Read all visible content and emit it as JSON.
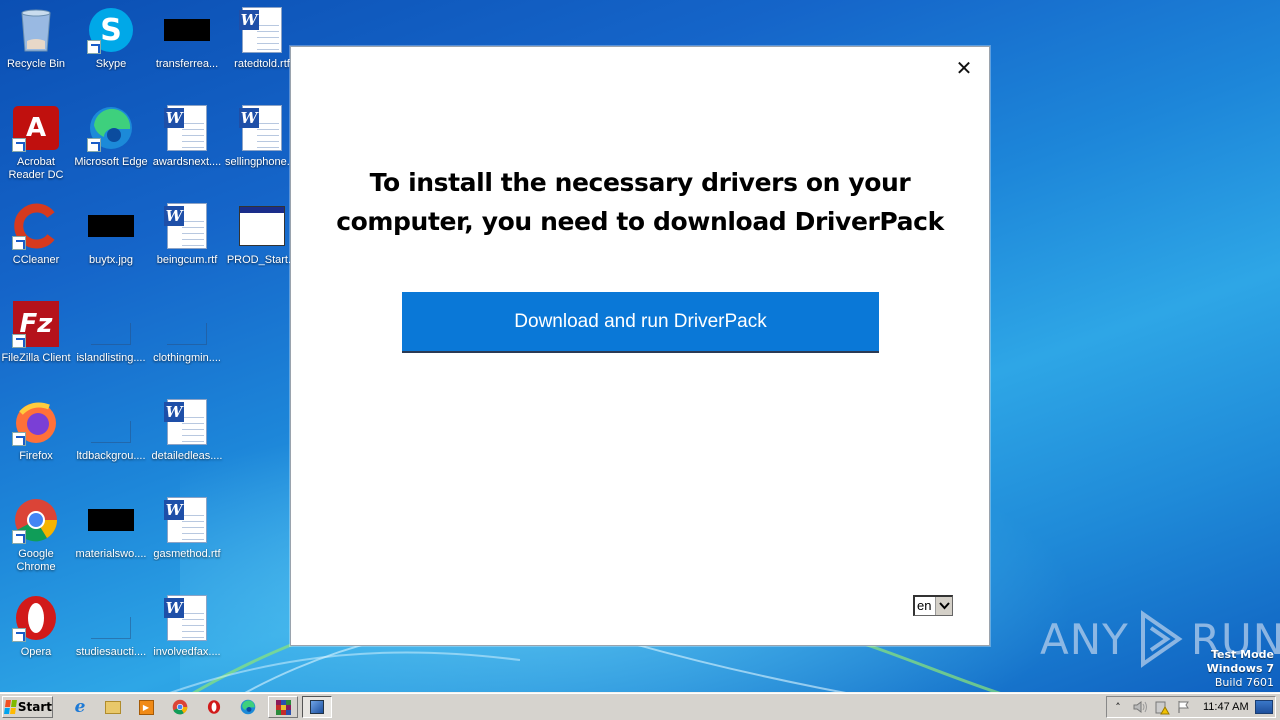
{
  "desktop": {
    "icons": [
      {
        "label": "Recycle Bin",
        "icon": "recycle-bin-icon"
      },
      {
        "label": "Skype",
        "icon": "skype-icon",
        "shortcut": true
      },
      {
        "label": "transferrea...",
        "icon": "black-image-thumbnail"
      },
      {
        "label": "ratedtold.rtf",
        "icon": "word-document-icon"
      },
      {
        "label": "Acrobat Reader DC",
        "icon": "acrobat-reader-icon",
        "shortcut": true
      },
      {
        "label": "Microsoft Edge",
        "icon": "edge-icon",
        "shortcut": true
      },
      {
        "label": "awardsnext....",
        "icon": "word-document-icon"
      },
      {
        "label": "sellingphone....",
        "icon": "word-document-icon"
      },
      {
        "label": "CCleaner",
        "icon": "ccleaner-icon",
        "shortcut": true
      },
      {
        "label": "buytx.jpg",
        "icon": "black-image-thumbnail"
      },
      {
        "label": "beingcum.rtf",
        "icon": "word-document-icon"
      },
      {
        "label": "PROD_Start...",
        "icon": "application-window-icon"
      },
      {
        "label": "FileZilla Client",
        "icon": "filezilla-icon",
        "shortcut": true
      },
      {
        "label": "islandlisting....",
        "icon": "blank-file-icon"
      },
      {
        "label": "clothingmin....",
        "icon": "blank-file-icon"
      },
      {
        "label": "Firefox",
        "icon": "firefox-icon",
        "shortcut": true
      },
      {
        "label": "ltdbackgrou....",
        "icon": "blank-file-icon"
      },
      {
        "label": "detailedleas....",
        "icon": "word-document-icon"
      },
      {
        "label": "Google Chrome",
        "icon": "chrome-icon",
        "shortcut": true
      },
      {
        "label": "materialswo....",
        "icon": "black-image-thumbnail"
      },
      {
        "label": "gasmethod.rtf",
        "icon": "word-document-icon"
      },
      {
        "label": "Opera",
        "icon": "opera-icon",
        "shortcut": true
      },
      {
        "label": "studiesaucti....",
        "icon": "blank-file-icon"
      },
      {
        "label": "involvedfax....",
        "icon": "word-document-icon"
      }
    ]
  },
  "dialog": {
    "close_label": "✕",
    "heading_line1": "To install the necessary drivers on your",
    "heading_line2": "computer, you need to download DriverPack",
    "download_button_label": "Download and run DriverPack",
    "language_selected": "en",
    "accent_color": "#0a78d7"
  },
  "watermark": {
    "left_text": "ANY",
    "right_text": "RUN"
  },
  "os_info": {
    "line1": "Test Mode",
    "line2": "Windows 7",
    "line3": "Build 7601"
  },
  "taskbar": {
    "start_label": "Start",
    "quick_launch": [
      "internet-explorer-icon",
      "file-explorer-icon",
      "media-player-icon",
      "chrome-icon",
      "opera-icon",
      "edge-icon"
    ],
    "tasks": [
      "winrar-icon",
      "driverpack-installer-icon"
    ],
    "tray": {
      "clock": "11:47 AM"
    }
  }
}
